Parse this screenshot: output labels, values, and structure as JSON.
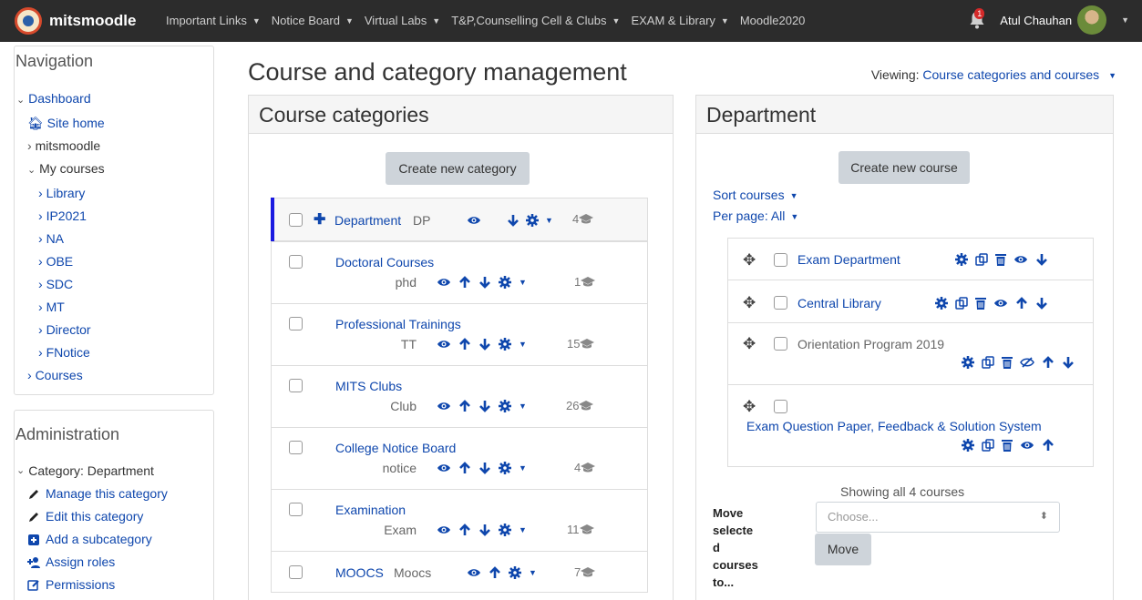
{
  "navbar": {
    "brand": "mitsmoodle",
    "menu": [
      {
        "label": "Important Links",
        "caret": true
      },
      {
        "label": "Notice Board",
        "caret": true
      },
      {
        "label": "Virtual Labs",
        "caret": true
      },
      {
        "label": "T&P,Counselling Cell & Clubs",
        "caret": true
      },
      {
        "label": "EXAM & Library",
        "caret": true
      },
      {
        "label": "Moodle2020",
        "caret": false
      }
    ],
    "notification_count": "1",
    "user_name": "Atul Chauhan"
  },
  "navigation": {
    "title": "Navigation",
    "dashboard": "Dashboard",
    "site_home": "Site home",
    "mitsmoodle": "mitsmoodle",
    "my_courses": "My courses",
    "courses": [
      "Library",
      "IP2021",
      "NA",
      "OBE",
      "SDC",
      "MT",
      "Director",
      "FNotice"
    ],
    "courses_label": "Courses"
  },
  "administration": {
    "title": "Administration",
    "category": "Category: Department",
    "items": [
      {
        "label": "Manage this category",
        "icon": "pencil-icon"
      },
      {
        "label": "Edit this category",
        "icon": "pencil-icon"
      },
      {
        "label": "Add a subcategory",
        "icon": "plus-square-icon"
      },
      {
        "label": "Assign roles",
        "icon": "user-plus-icon"
      },
      {
        "label": "Permissions",
        "icon": "edit-square-icon"
      }
    ]
  },
  "main": {
    "title": "Course and category management",
    "viewing_label": "Viewing:",
    "viewing_value": "Course categories and courses"
  },
  "categories_panel": {
    "title": "Course categories",
    "create_button": "Create new category",
    "department": {
      "name": "Department",
      "idnumber": "DP",
      "count": "4"
    },
    "items": [
      {
        "name": "Doctoral Courses",
        "idnumber": "phd",
        "count": "1"
      },
      {
        "name": "Professional Trainings",
        "idnumber": "TT",
        "count": "15"
      },
      {
        "name": "MITS Clubs",
        "idnumber": "Club",
        "count": "26"
      },
      {
        "name": "College Notice Board",
        "idnumber": "notice",
        "count": "4"
      },
      {
        "name": "Examination",
        "idnumber": "Exam",
        "count": "11"
      }
    ],
    "moocs": {
      "name": "MOOCS",
      "idnumber": "Moocs",
      "count": "7"
    }
  },
  "department_panel": {
    "title": "Department",
    "create_button": "Create new course",
    "sort_courses": "Sort courses",
    "per_page": "Per page: All",
    "courses": [
      {
        "name": "Exam Department",
        "hidden": false
      },
      {
        "name": "Central Library",
        "hidden": false
      },
      {
        "name": "Orientation Program 2019",
        "hidden": true
      },
      {
        "name": "Exam Question Paper, Feedback & Solution System",
        "hidden": false
      }
    ],
    "showing": "Showing all 4 courses",
    "move_label_lines": [
      "Move",
      "selecte",
      "d",
      "courses",
      "to..."
    ],
    "choose_placeholder": "Choose...",
    "move_button": "Move"
  },
  "colors": {
    "link": "#0f47ad",
    "navbar": "#2c2c2c",
    "button": "#ced4da",
    "active_bar": "#1a1ae0"
  }
}
